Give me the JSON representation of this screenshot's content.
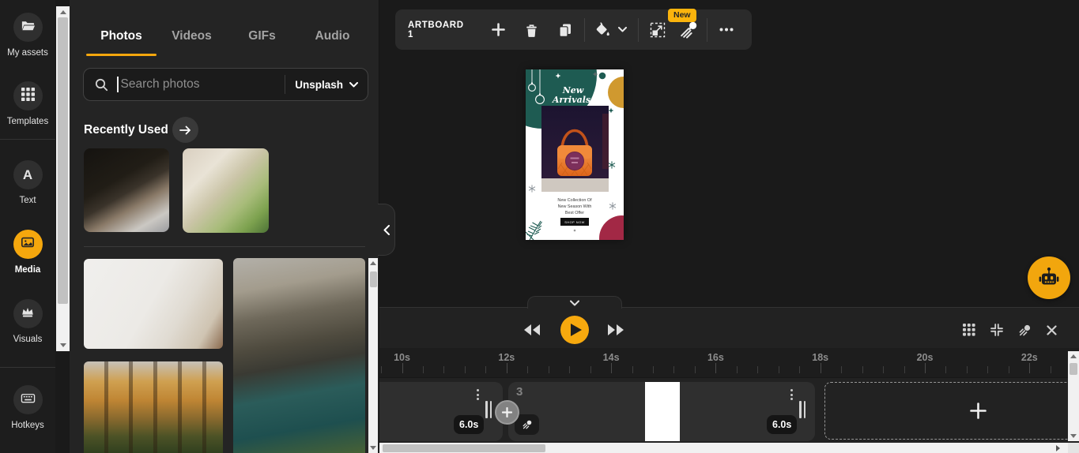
{
  "app": {
    "accent_color": "#F5A70D",
    "background_color": "#1a1a1a"
  },
  "sidebar": {
    "items": [
      {
        "label": "My assets",
        "icon": "folder-open-icon",
        "active": false
      },
      {
        "label": "Templates",
        "icon": "templates-grid-icon",
        "active": false
      },
      {
        "label": "Text",
        "icon": "text-a-icon",
        "active": false
      },
      {
        "label": "Media",
        "icon": "media-image-icon",
        "active": true
      },
      {
        "label": "Visuals",
        "icon": "crown-icon",
        "active": false
      },
      {
        "label": "Hotkeys",
        "icon": "keyboard-icon",
        "active": false
      }
    ]
  },
  "media_panel": {
    "tabs": [
      {
        "label": "Photos",
        "active": true
      },
      {
        "label": "Videos",
        "active": false
      },
      {
        "label": "GIFs",
        "active": false
      },
      {
        "label": "Audio",
        "active": false
      }
    ],
    "search": {
      "placeholder": "Search photos",
      "provider": "Unsplash",
      "icons": [
        "search-icon",
        "chevron-down-icon"
      ]
    },
    "recently_used": {
      "title": "Recently Used",
      "items": [
        "typing-on-laptop-photo",
        "desk-with-laptop-photo"
      ]
    },
    "photos": [
      "workspace-flatlay-photo",
      "sea-cliffs-photo",
      "autumn-forest-photo"
    ]
  },
  "toolbar": {
    "artboard_label": "ARTBOARD 1",
    "new_badge": "New",
    "icons": [
      "plus-icon",
      "trash-icon",
      "duplicate-icon",
      "fill-color-icon",
      "chevron-down-icon",
      "resize-icon",
      "animate-magic-icon",
      "more-ellipsis-icon"
    ]
  },
  "artboard": {
    "heading_line1": "New",
    "heading_line2": "Arrivals",
    "body_line1": "New Collection Of",
    "body_line2": "New Season With",
    "body_line3": "Best Offer",
    "button_label": "SHOP NOW",
    "colors": {
      "teal": "#1E5B52",
      "mustard": "#D0992F",
      "crimson": "#A22845",
      "bag_orange": "#E8732B",
      "badge_purple": "#7C2F5B"
    }
  },
  "assistant": {
    "icon": "robot-icon"
  },
  "timeline": {
    "ruler_labels": [
      "10s",
      "12s",
      "14s",
      "16s",
      "18s",
      "20s",
      "22s"
    ],
    "clips": [
      {
        "duration": "6.0s"
      },
      {
        "number": "3",
        "duration": "6.0s"
      }
    ],
    "icons": [
      "rewind-icon",
      "play-icon",
      "fast-forward-icon",
      "grid-view-icon",
      "collapse-icon",
      "magic-effects-icon",
      "close-icon",
      "add-scene-plus-icon"
    ]
  }
}
